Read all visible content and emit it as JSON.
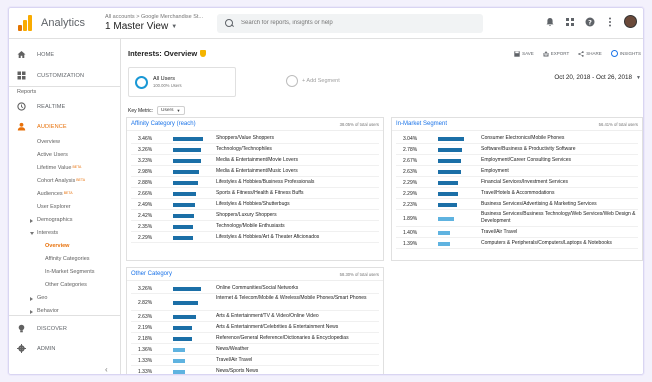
{
  "app": {
    "name": "Analytics"
  },
  "account": {
    "path": "All accounts > Google Merchandise St...",
    "view": "1 Master View"
  },
  "search": {
    "placeholder": "Search for reports, insights or help"
  },
  "colors": {
    "accent": "#e8710a",
    "link": "#1a73e8",
    "bar_dark": "#1b6fa7",
    "bar_light": "#5fb3e0",
    "logo": [
      "#f9ab00",
      "#e37400",
      "#e37400"
    ]
  },
  "sidebar": {
    "home": "HOME",
    "customization": "CUSTOMIZATION",
    "reports_heading": "Reports",
    "realtime": "REALTIME",
    "audience": "AUDIENCE",
    "sub": {
      "overview": "Overview",
      "active_users": "Active Users",
      "lifetime_value": "Lifetime Value",
      "cohort_analysis": "Cohort Analysis",
      "audiences": "Audiences",
      "beta": "BETA",
      "user_explorer": "User Explorer",
      "demographics": "Demographics",
      "interests": "Interests",
      "interests_overview": "Overview",
      "affinity": "Affinity Categories",
      "in_market": "In-Market Segments",
      "other": "Other Categories",
      "geo": "Geo",
      "behavior": "Behavior"
    },
    "discover": "DISCOVER",
    "admin": "ADMIN"
  },
  "page": {
    "title": "Interests: Overview"
  },
  "actions": {
    "save": "SAVE",
    "export": "EXPORT",
    "share": "SHARE",
    "insights": "INSIGHTS"
  },
  "segment": {
    "name": "All Users",
    "pct": "100.00% Users",
    "add": "+ Add Segment"
  },
  "date_range": "Oct 20, 2018 - Oct 26, 2018",
  "key_metric": {
    "label": "Key Metric:",
    "value": "Users"
  },
  "affinity": {
    "title": "Affinity Category (reach)",
    "total": "38.05% of total users",
    "rows": [
      {
        "pct": "3.46%",
        "value": 3.46,
        "label": "Shoppers/Value Shoppers"
      },
      {
        "pct": "3.26%",
        "value": 3.26,
        "label": "Technology/Technophiles"
      },
      {
        "pct": "3.23%",
        "value": 3.23,
        "label": "Media & Entertainment/Movie Lovers"
      },
      {
        "pct": "2.98%",
        "value": 2.98,
        "label": "Media & Entertainment/Music Lovers"
      },
      {
        "pct": "2.88%",
        "value": 2.88,
        "label": "Lifestyles & Hobbies/Business Professionals"
      },
      {
        "pct": "2.66%",
        "value": 2.66,
        "label": "Sports & Fitness/Health & Fitness Buffs"
      },
      {
        "pct": "2.49%",
        "value": 2.49,
        "label": "Lifestyles & Hobbies/Shutterbugs"
      },
      {
        "pct": "2.42%",
        "value": 2.42,
        "label": "Shoppers/Luxury Shoppers"
      },
      {
        "pct": "2.35%",
        "value": 2.35,
        "label": "Technology/Mobile Enthusiasts"
      },
      {
        "pct": "2.29%",
        "value": 2.29,
        "label": "Lifestyles & Hobbies/Art & Theater Aficionados"
      }
    ]
  },
  "in_market": {
    "title": "In-Market Segment",
    "total": "56.41% of total users",
    "rows": [
      {
        "pct": "3.04%",
        "value": 3.04,
        "label": "Consumer Electronics/Mobile Phones"
      },
      {
        "pct": "2.78%",
        "value": 2.78,
        "label": "Software/Business & Productivity Software"
      },
      {
        "pct": "2.67%",
        "value": 2.67,
        "label": "Employment/Career Consulting Services"
      },
      {
        "pct": "2.63%",
        "value": 2.63,
        "label": "Employment"
      },
      {
        "pct": "2.29%",
        "value": 2.29,
        "label": "Financial Services/Investment Services"
      },
      {
        "pct": "2.29%",
        "value": 2.29,
        "label": "Travel/Hotels & Accommodations"
      },
      {
        "pct": "2.23%",
        "value": 2.23,
        "label": "Business Services/Advertising & Marketing Services"
      },
      {
        "pct": "1.89%",
        "value": 1.89,
        "label": "Business Services/Business Technology/Web Services/Web Design & Development"
      },
      {
        "pct": "1.40%",
        "value": 1.4,
        "label": "Travel/Air Travel"
      },
      {
        "pct": "1.39%",
        "value": 1.39,
        "label": "Computers & Peripherals/Computers/Laptops & Notebooks"
      }
    ]
  },
  "other": {
    "title": "Other Category",
    "total": "58.30% of total users",
    "rows": [
      {
        "pct": "3.26%",
        "value": 3.26,
        "label": "Online Communities/Social Networks"
      },
      {
        "pct": "2.82%",
        "value": 2.82,
        "label": "Internet & Telecom/Mobile & Wireless/Mobile Phones/Smart Phones"
      },
      {
        "pct": "2.63%",
        "value": 2.63,
        "label": "Arts & Entertainment/TV & Video/Online Video"
      },
      {
        "pct": "2.19%",
        "value": 2.19,
        "label": "Arts & Entertainment/Celebrities & Entertainment News"
      },
      {
        "pct": "2.18%",
        "value": 2.18,
        "label": "Reference/General Reference/Dictionaries & Encyclopedias"
      },
      {
        "pct": "1.36%",
        "value": 1.36,
        "label": "News/Weather"
      },
      {
        "pct": "1.33%",
        "value": 1.33,
        "label": "Travel/Air Travel"
      },
      {
        "pct": "1.33%",
        "value": 1.33,
        "label": "News/Sports News"
      }
    ]
  }
}
